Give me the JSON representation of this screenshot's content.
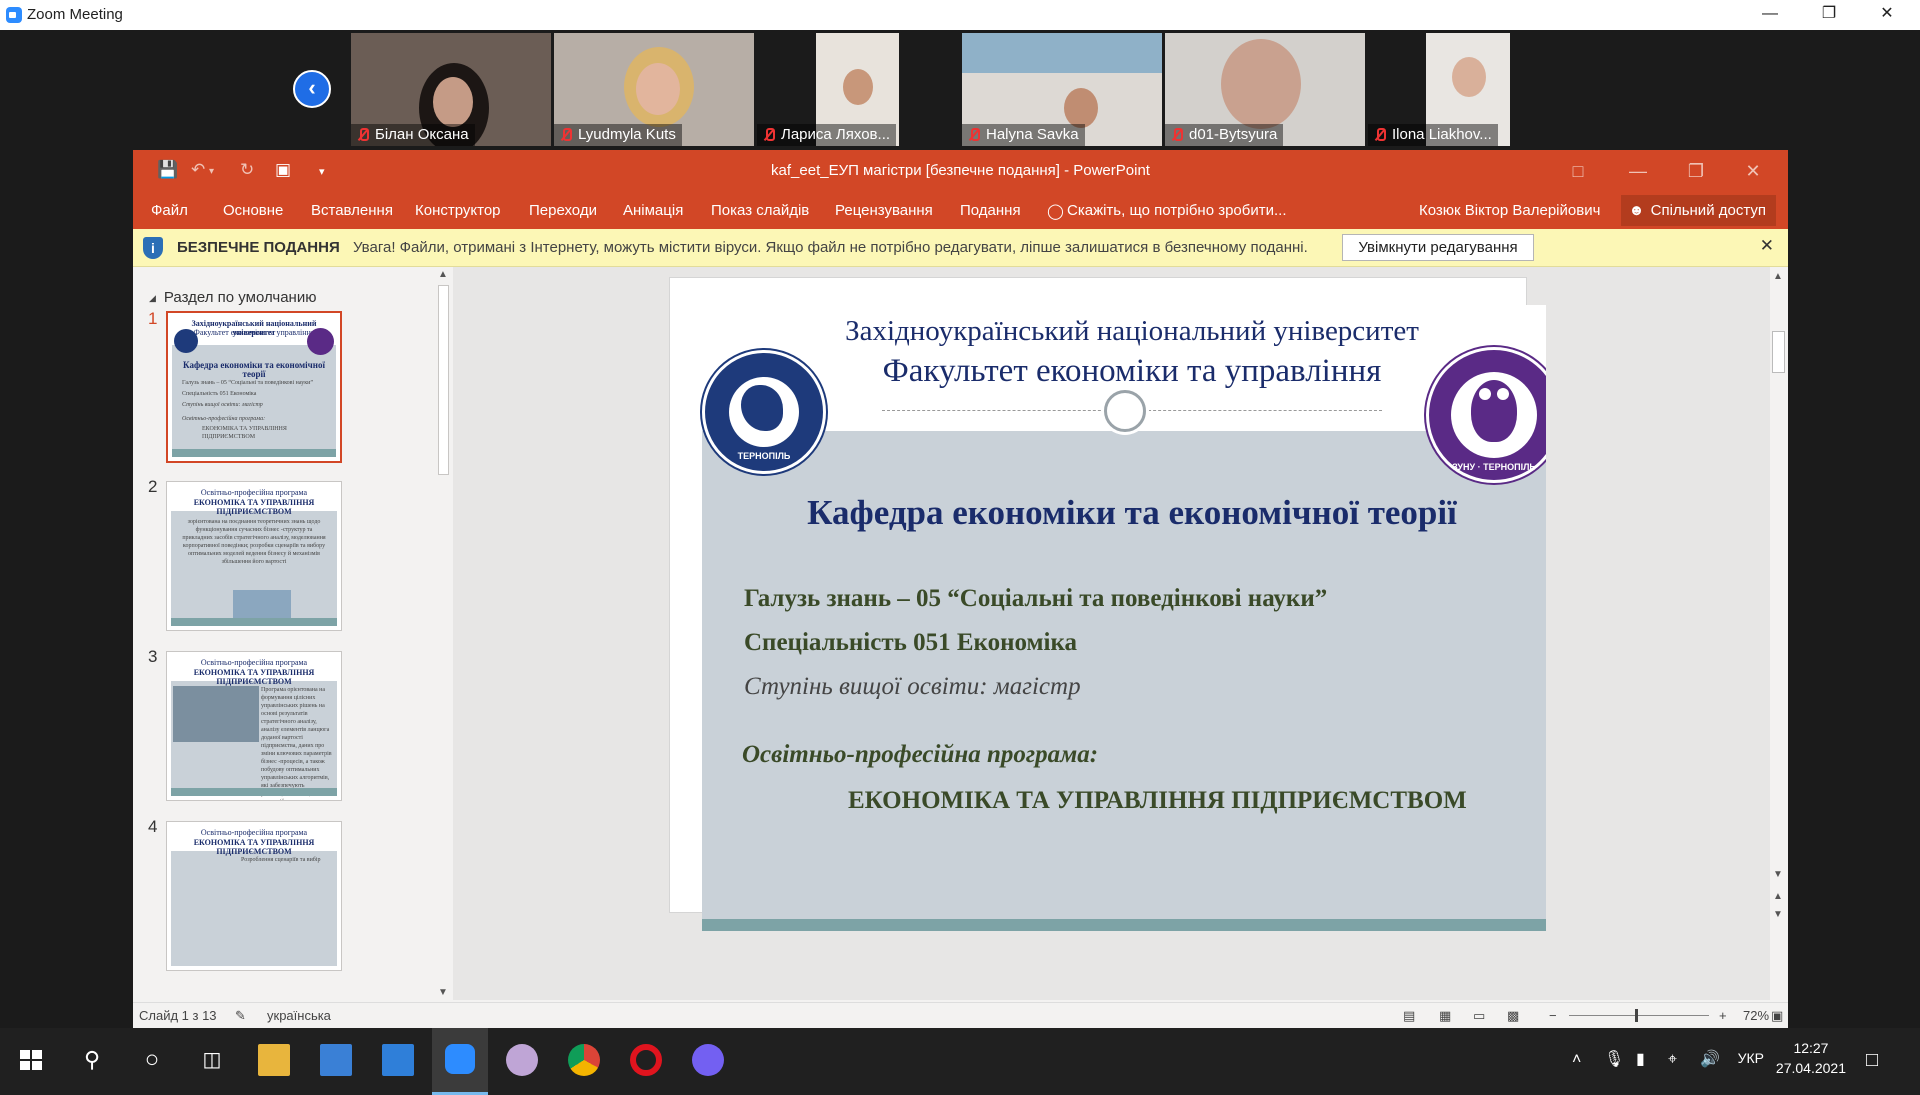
{
  "zoom": {
    "window_title": "Zoom Meeting",
    "participants": [
      {
        "name": "Білан Оксана"
      },
      {
        "name": "Lyudmyla Kuts"
      },
      {
        "name": "Лариса Ляхов..."
      },
      {
        "name": "Halyna Savka"
      },
      {
        "name": "d01-Bytsyura"
      },
      {
        "name": "Ilona Liakhov..."
      }
    ]
  },
  "ppt": {
    "doc_title": "kaf_eet_ЕУП магістри [безпечне подання] - PowerPoint",
    "ribbon_tabs": [
      "Файл",
      "Основне",
      "Вставлення",
      "Конструктор",
      "Переходи",
      "Анімація",
      "Показ слайдів",
      "Рецензування",
      "Подання"
    ],
    "tell_me": "Скажіть, що потрібно зробити...",
    "user": "Козюк Віктор Валерійович",
    "share": "Спільний доступ",
    "protected": {
      "label": "БЕЗПЕЧНЕ ПОДАННЯ",
      "message": "Увага! Файли, отримані з Інтернету, можуть містити віруси. Якщо файл не потрібно редагувати, ліпше залишатися в безпечному поданні.",
      "enable_button": "Увімкнути редагування"
    },
    "section_name": "Раздел по умолчанию",
    "thumbnails": [
      {
        "num": "1",
        "title": "Західноукраїнський національний університет",
        "subtitle": "Факультет економіки та управління",
        "heading": "Кафедра економіки та економічної теорії",
        "lines": [
          "Галузь знань – 05 “Соціальні та поведінкові науки”",
          "Спеціальність 051 Економіка",
          "Ступінь вищої освіти: магістр",
          "Освітньо-професійна програма:",
          "ЕКОНОМІКА ТА УПРАВЛІННЯ ПІДПРИЄМСТВОМ"
        ]
      },
      {
        "num": "2",
        "title": "Освітньо-професійна програма",
        "subtitle": "ЕКОНОМІКА ТА УПРАВЛІННЯ ПІДПРИЄМСТВОМ",
        "lines": [
          "зорієнтована на поєднання теоретичних знань щодо функціонування сучасних бізнес -структур та прикладних засобів стратегічного аналізу, моделювання корпоративної поведінки; розробки сценаріїв та вибору оптимальних моделей ведення бізнесу й механізмів збільшення його вартості"
        ]
      },
      {
        "num": "3",
        "title": "Освітньо-професійна програма",
        "subtitle": "ЕКОНОМІКА ТА УПРАВЛІННЯ ПІДПРИЄМСТВОМ",
        "lines": [
          "Програма орієнтована на формування цілісних управлінських рішень на основі результатів стратегічного аналізу, аналізу елементів ланцюга доданої вартості підприємства, даних про зміни ключових параметрів бізнес -процесів, а також побудову оптимальних управлінських алгоритмів, які забезпечують реалізацію інноваційних стратегій та нарощування стратегічних змін на підприємстві."
        ]
      },
      {
        "num": "4",
        "title": "Освітньо-професійна програма",
        "subtitle": "ЕКОНОМІКА ТА УПРАВЛІННЯ ПІДПРИЄМСТВОМ",
        "lines": [
          "Розроблення сценаріїв та вибір"
        ]
      }
    ],
    "slide": {
      "university": "Західноукраїнський національний університет",
      "faculty": "Факультет економіки та управління",
      "department": "Кафедра економіки та економічної теорії",
      "field": "Галузь знань – 05 “Соціальні та поведінкові науки”",
      "specialty": "Спеціальність 051 Економіка",
      "degree": "Ступінь вищої освіти: магістр",
      "program_label": "Освітньо-професійна програма:",
      "program_name": "ЕКОНОМІКА ТА УПРАВЛІННЯ ПІДПРИЄМСТВОМ",
      "logo_left_text": "ТЕРНОПІЛЬ",
      "logo_right_text": "ЗУНУ · ТЕРНОПІЛЬ"
    },
    "status": {
      "slide_counter": "Слайд 1 з 13",
      "language": "українська",
      "zoom": "72%"
    }
  },
  "taskbar": {
    "language": "УКР",
    "time": "12:27",
    "date": "27.04.2021"
  },
  "colors": {
    "ppt_accent": "#d24726",
    "slide_navy": "#1a2c6b",
    "slide_gray": "#c9d1d8",
    "slide_teal": "#7da3a6",
    "warning_bar": "#fcf7b6"
  }
}
